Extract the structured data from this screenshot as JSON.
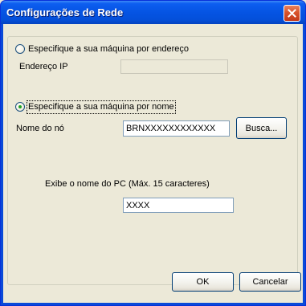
{
  "window": {
    "title": "Configurações de Rede"
  },
  "address_option": {
    "label": "Especifique a sua máquina por endereço",
    "selected": false,
    "ip_label": "Endereço IP",
    "ip_value": ""
  },
  "name_option": {
    "label": "Especifique a sua máquina por nome",
    "selected": true,
    "node_label": "Nome do nó",
    "node_value": "BRNXXXXXXXXXXXX",
    "search_button": "Busca..."
  },
  "pc_name": {
    "label": "Exibe o nome do PC (Máx. 15 caracteres)",
    "value": "XXXX"
  },
  "buttons": {
    "ok": "OK",
    "cancel": "Cancelar"
  },
  "icons": {
    "close": "close-icon"
  }
}
